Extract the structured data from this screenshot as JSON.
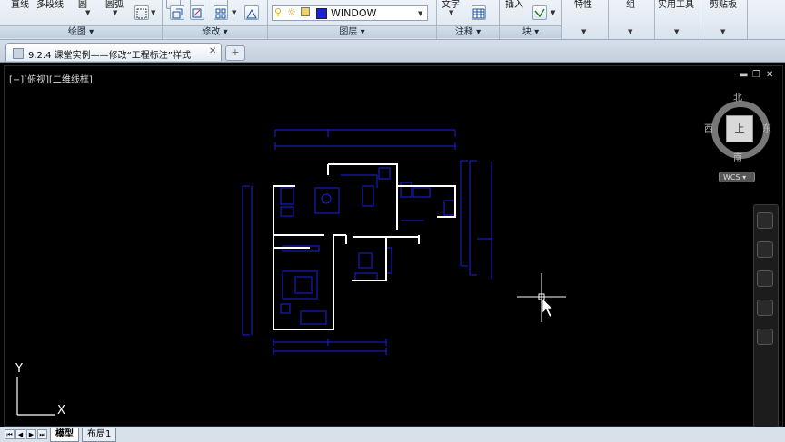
{
  "ribbon": {
    "draw": {
      "line": "直线",
      "polyline": "多段线",
      "circle": "圆",
      "arc": "圆弧",
      "title": "绘图"
    },
    "modify": {
      "title": "修改"
    },
    "layers": {
      "current_layer": "WINDOW",
      "title": "图层"
    },
    "annotation": {
      "text": "文字",
      "title": "注释"
    },
    "block": {
      "insert": "插入",
      "title": "块"
    },
    "properties": {
      "label": "特性"
    },
    "groups": {
      "label": "组"
    },
    "utilities": {
      "label": "实用工具"
    },
    "clipboard": {
      "label": "剪贴板"
    }
  },
  "tabs": [
    {
      "label": "9.2.4 课堂实例——修改“工程标注”样式"
    }
  ],
  "viewport": {
    "label": "[−][俯视][二维线框]",
    "viewcube": {
      "north": "北",
      "south": "南",
      "east": "东",
      "west": "西",
      "face": "上",
      "wcs": "WCS"
    },
    "ucs": {
      "x": "X",
      "y": "Y"
    }
  },
  "layout_tabs": [
    {
      "label": "模型"
    },
    {
      "label": "布局1"
    }
  ],
  "colors": {
    "drawing_blue": "#1a22e0",
    "walls": "#ffffff",
    "background": "#000000"
  }
}
